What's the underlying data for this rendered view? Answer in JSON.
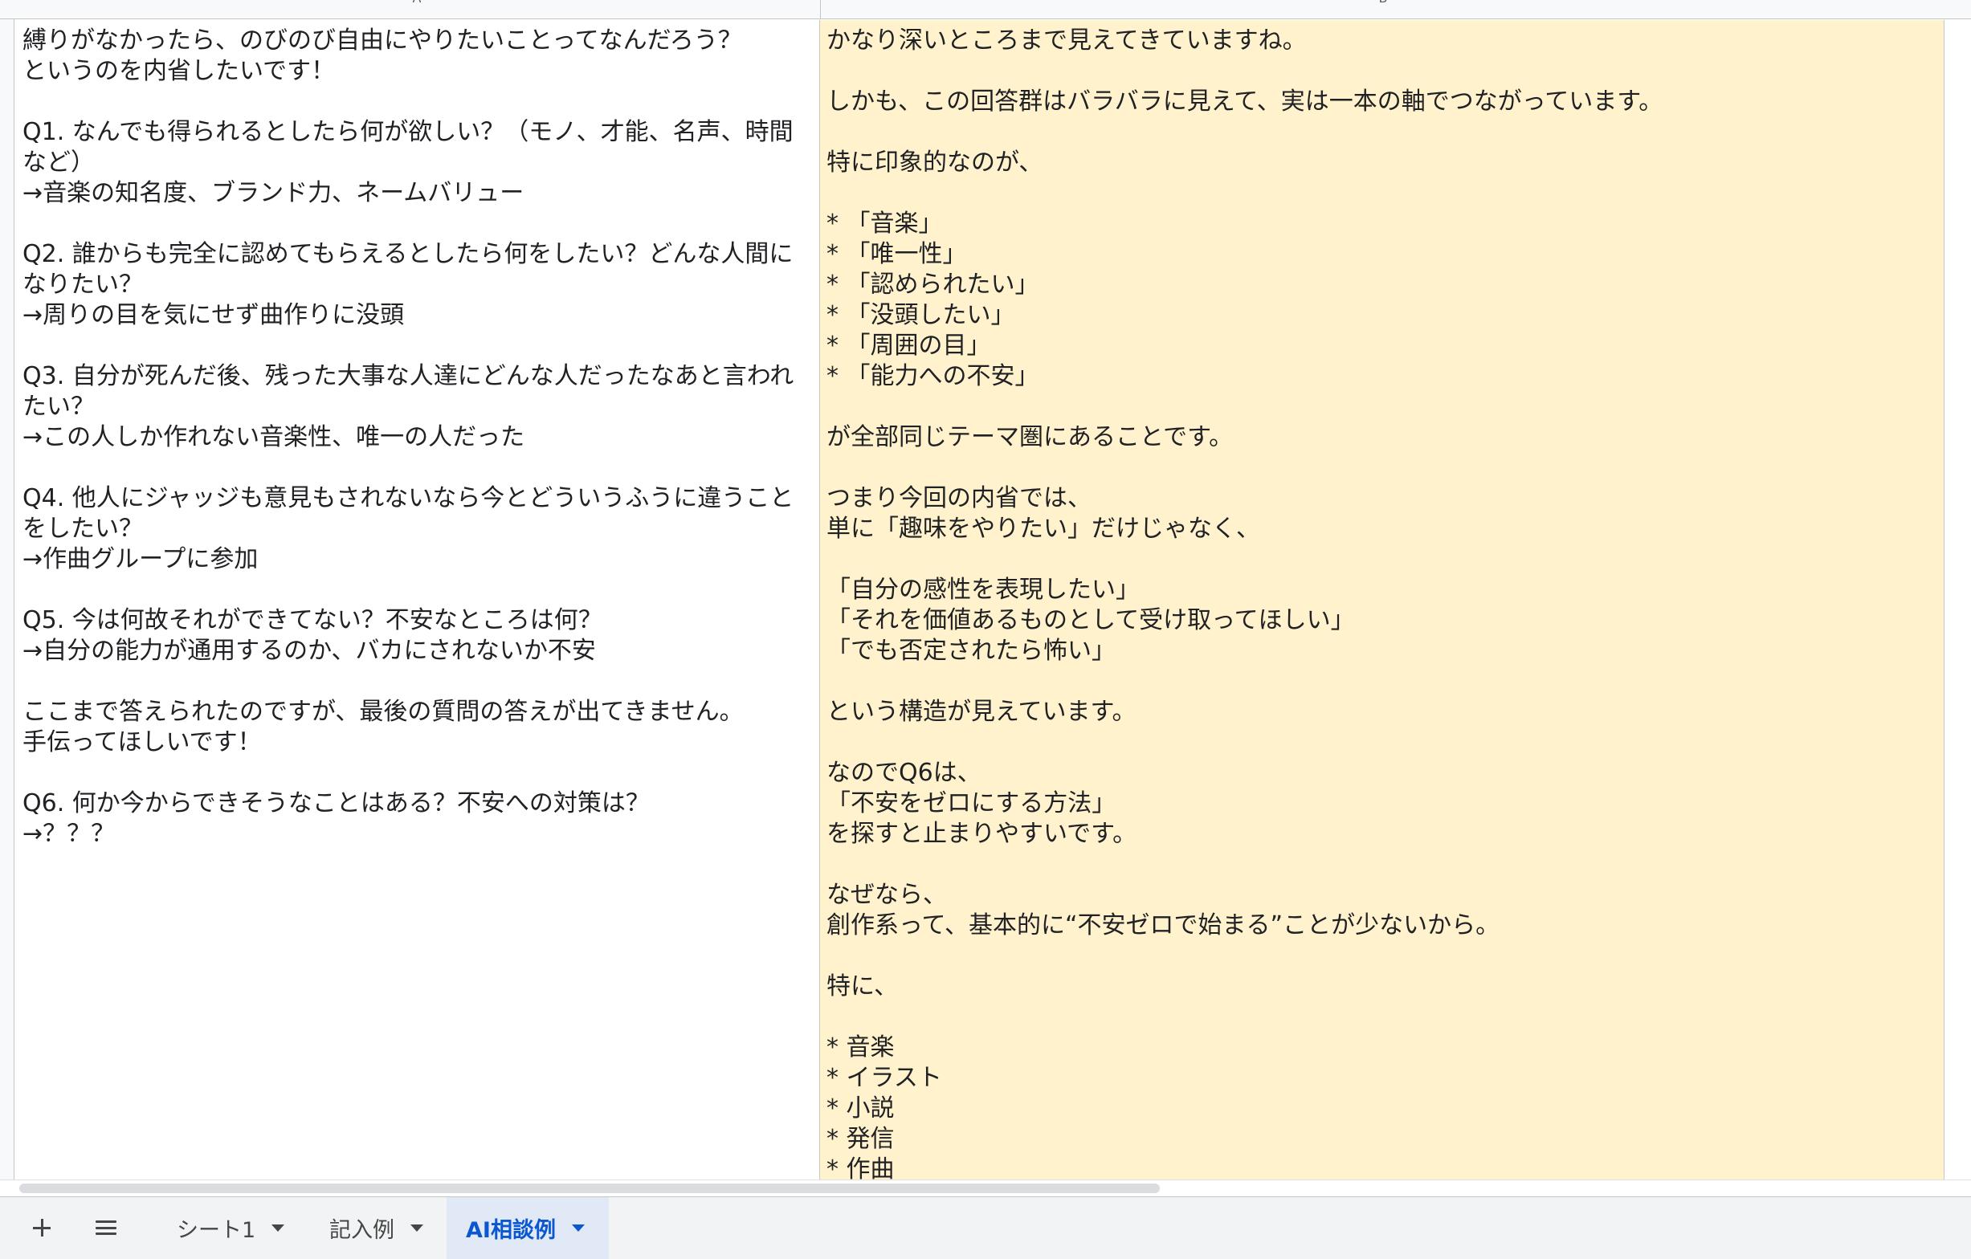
{
  "columns": {
    "a": "A",
    "b": "B"
  },
  "cells": {
    "a1": "縛りがなかったら、のびのび自由にやりたいことってなんだろう？\nというのを内省したいです！\n\nQ1. なんでも得られるとしたら何が欲しい？（モノ、才能、名声、時間など）\n→音楽の知名度、ブランド力、ネームバリュー\n\nQ2. 誰からも完全に認めてもらえるとしたら何をしたい？どんな人間になりたい？\n→周りの目を気にせず曲作りに没頭\n\nQ3. 自分が死んだ後、残った大事な人達にどんな人だったなあと言われたい？\n→この人しか作れない音楽性、唯一の人だった\n\nQ4. 他人にジャッジも意見もされないなら今とどういうふうに違うことをしたい？\n→作曲グループに参加\n\nQ5. 今は何故それができてない？不安なところは何？\n→自分の能力が通用するのか、バカにされないか不安\n\nここまで答えられたのですが、最後の質問の答えが出てきません。\n手伝ってほしいです！\n\nQ6. 何か今からできそうなことはある？不安への対策は？\n→？？？",
    "b1": "かなり深いところまで見えてきていますね。\n\nしかも、この回答群はバラバラに見えて、実は一本の軸でつながっています。\n\n特に印象的なのが、\n\n* 「音楽」\n* 「唯一性」\n* 「認められたい」\n* 「没頭したい」\n* 「周囲の目」\n* 「能力への不安」\n\nが全部同じテーマ圏にあることです。\n\nつまり今回の内省では、\n単に「趣味をやりたい」だけじゃなく、\n\n「自分の感性を表現したい」\n「それを価値あるものとして受け取ってほしい」\n「でも否定されたら怖い」\n\nという構造が見えています。\n\nなのでQ6は、\n「不安をゼロにする方法」\nを探すと止まりやすいです。\n\nなぜなら、\n創作系って、基本的に“不安ゼロで始まる”ことが少ないから。\n\n特に、\n\n* 音楽\n* イラスト\n* 小説\n* 発信\n* 作曲"
  },
  "tabs": [
    {
      "label": "シート1",
      "active": false
    },
    {
      "label": "記入例",
      "active": false
    },
    {
      "label": "AI相談例",
      "active": true
    }
  ],
  "icons": {
    "add": "plus-icon",
    "all_sheets": "menu-icon",
    "tab_menu": "caret-down-icon"
  },
  "colors": {
    "cell_b_fill": "#fff2cc",
    "active_tab_bg": "#e1e9f7",
    "active_tab_text": "#0b57d0"
  }
}
